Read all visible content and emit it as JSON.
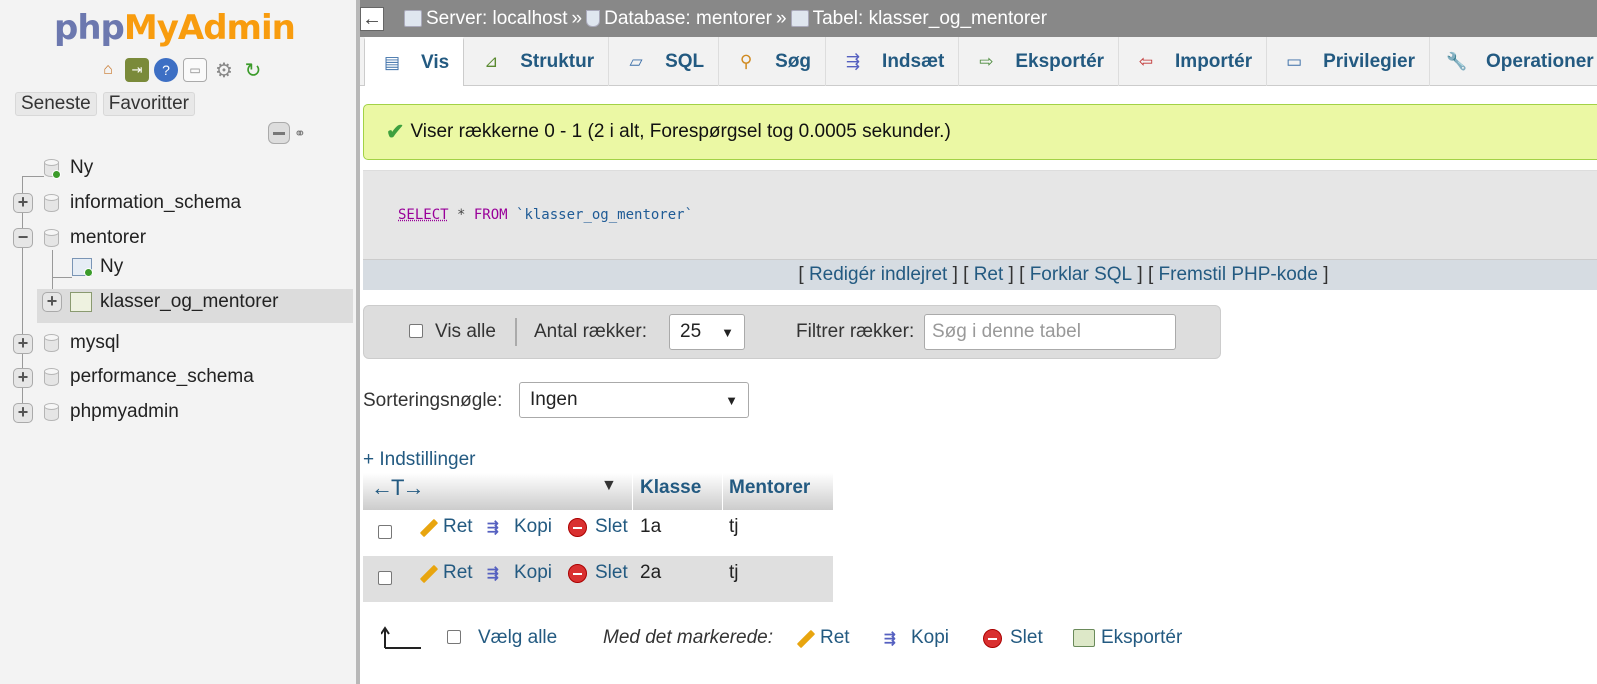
{
  "sidebar": {
    "logo_php": "php",
    "logo_my": "MyAdmin",
    "recent": "Seneste",
    "favorites": "Favoritter",
    "tree": {
      "new": "Ny",
      "db1": "information_schema",
      "db2": "mentorer",
      "db2_new": "Ny",
      "db2_table": "klasser_og_mentorer",
      "db3": "mysql",
      "db4": "performance_schema",
      "db5": "phpmyadmin"
    }
  },
  "breadcrumb": {
    "server": "Server: localhost",
    "database": "Database: mentorer",
    "table": "Tabel: klasser_og_mentorer",
    "sep": "»"
  },
  "tabs": [
    "Vis",
    "Struktur",
    "SQL",
    "Søg",
    "Indsæt",
    "Eksportér",
    "Importér",
    "Privilegier",
    "Operationer"
  ],
  "message": "Viser rækkerne 0 - 1 (2 i alt, Forespørgsel tog 0.0005 sekunder.)",
  "sql": {
    "select": "SELECT",
    "star": " * ",
    "from": "FROM",
    "table": " `klasser_og_mentorer`",
    "links": {
      "edit_inline": "Redigér indlejret",
      "edit": "Ret",
      "explain": "Forklar SQL",
      "php_code": "Fremstil PHP-kode"
    }
  },
  "navbar": {
    "show_all": "Vis alle",
    "rows_label": "Antal rækker:",
    "rows_value": "25",
    "filter_label": "Filtrer rækker:",
    "filter_placeholder": "Søg i denne tabel"
  },
  "sort": {
    "label": "Sorteringsnøgle:",
    "value": "Ingen"
  },
  "options_link": "+ Indstillinger",
  "table": {
    "col_arrows": "←T→",
    "headers": [
      "Klasse",
      "Mentorer"
    ],
    "rows": [
      {
        "klasse": "1a",
        "mentorer": "tj"
      },
      {
        "klasse": "2a",
        "mentorer": "tj"
      }
    ],
    "actions": {
      "edit": "Ret",
      "copy": "Kopi",
      "delete": "Slet"
    }
  },
  "bottom": {
    "select_all": "Vælg alle",
    "with_selected": "Med det markerede:",
    "edit": "Ret",
    "copy": "Kopi",
    "delete": "Slet",
    "export": "Eksportér"
  },
  "colors": {
    "link": "#235a81",
    "success_bg": "#ebf8a4",
    "logo_php": "#6c78af",
    "logo_my": "#f89c0e"
  }
}
